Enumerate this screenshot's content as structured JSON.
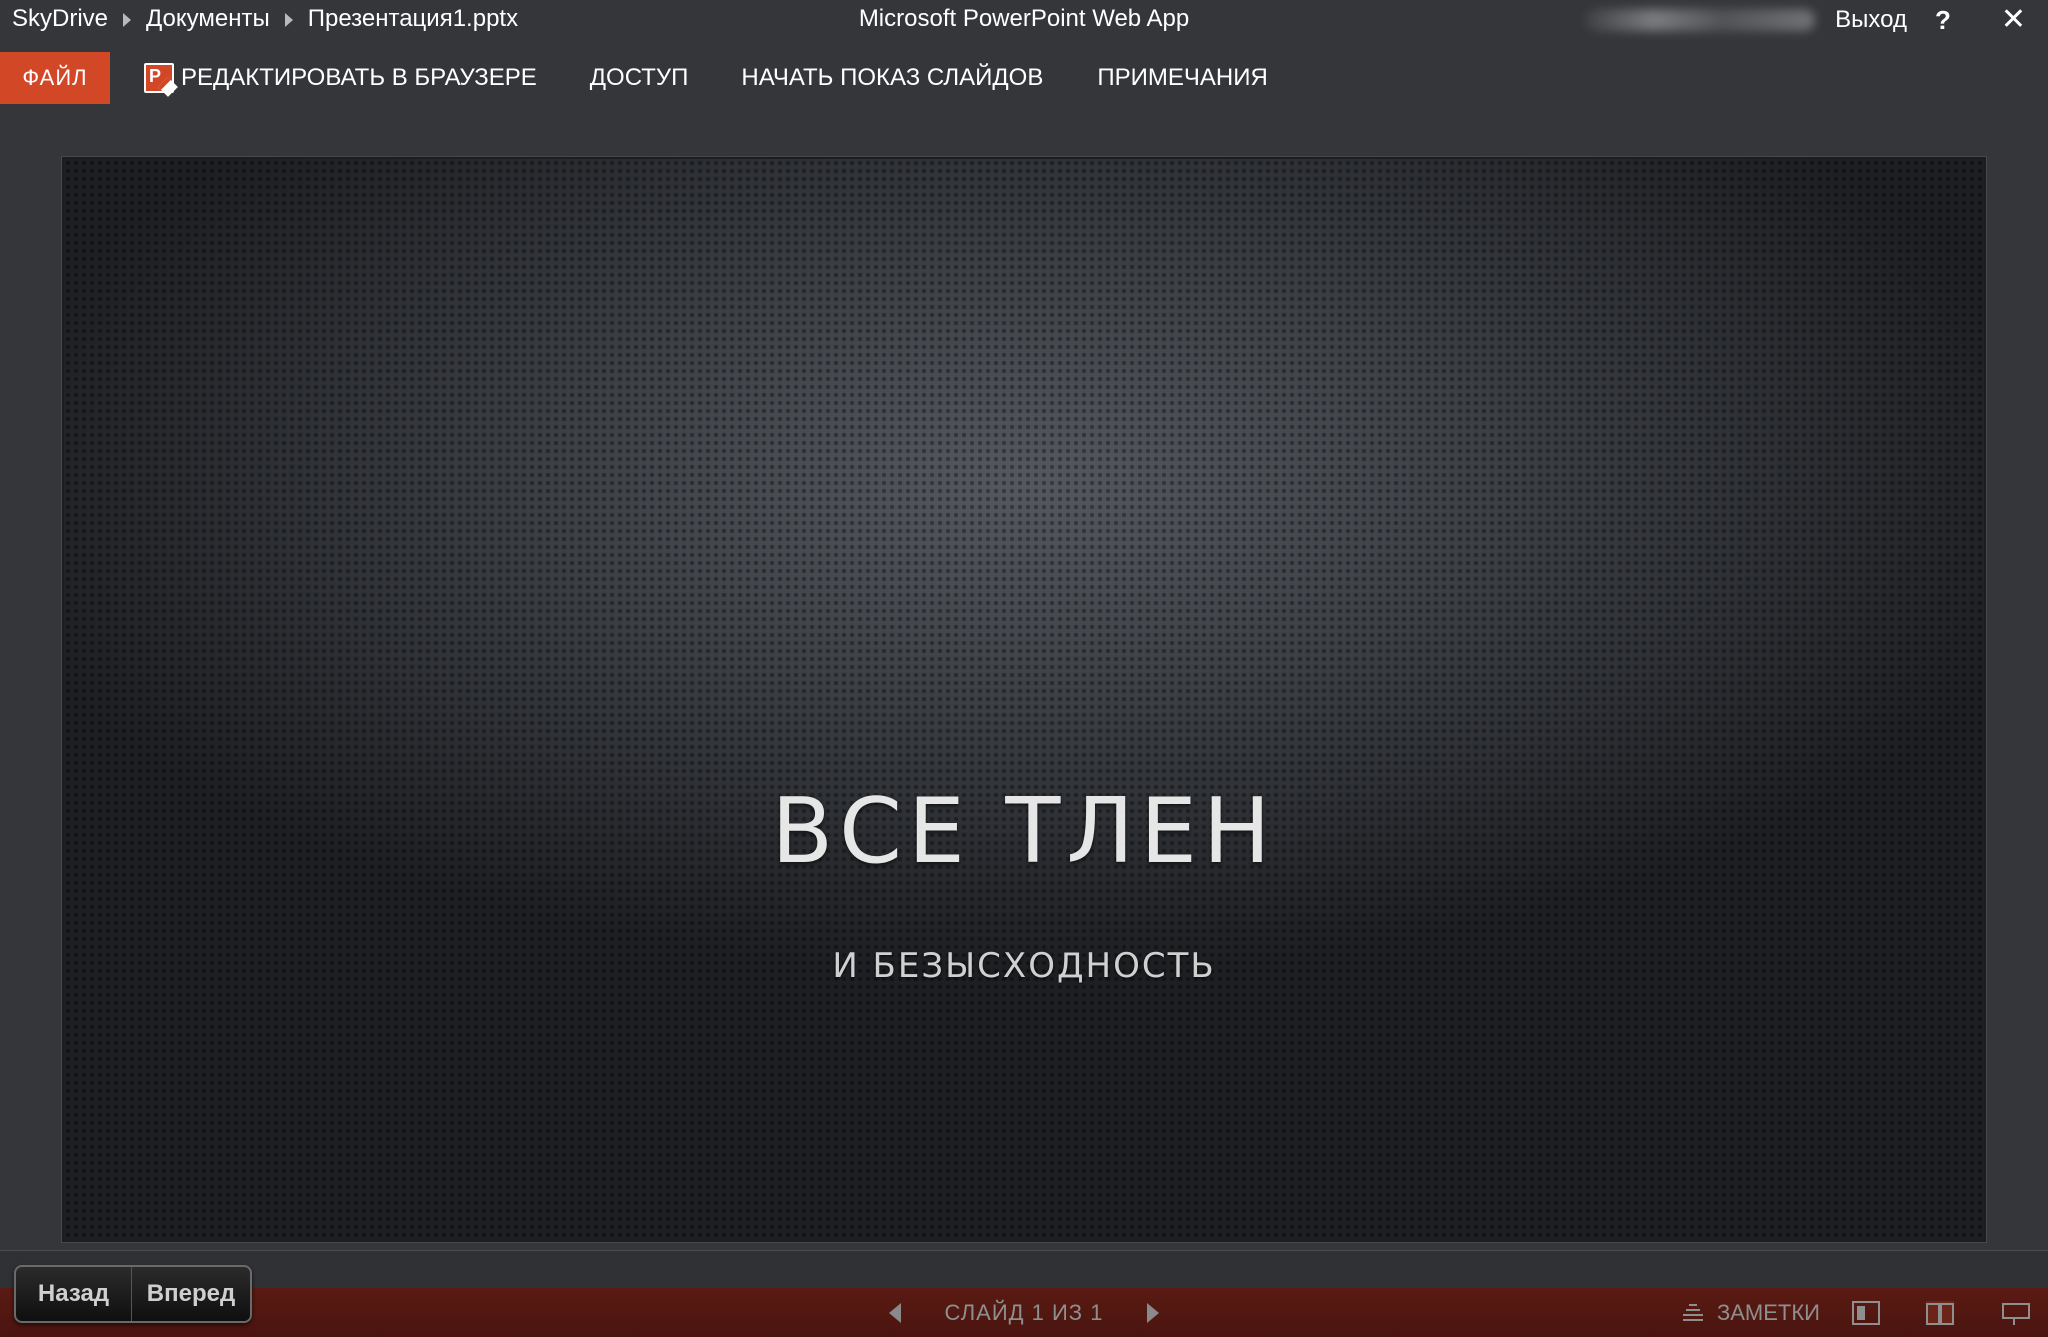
{
  "breadcrumb": [
    "SkyDrive",
    "Документы",
    "Презентация1.pptx"
  ],
  "app_title": "Microsoft PowerPoint Web App",
  "user": {
    "signout_label": "Выход",
    "help_glyph": "?",
    "close_glyph": "✕"
  },
  "ribbon": {
    "file_label": "ФАЙЛ",
    "edit_in_browser_label": "РЕДАКТИРОВАТЬ В БРАУЗЕРЕ",
    "share_label": "ДОСТУП",
    "start_slideshow_label": "НАЧАТЬ ПОКАЗ СЛАЙДОВ",
    "comments_label": "ПРИМЕЧАНИЯ"
  },
  "slide": {
    "title": "ВСЕ ТЛЕН",
    "subtitle": "И БЕЗЫСХОДНОСТЬ"
  },
  "navigation": {
    "back_label": "Назад",
    "forward_label": "Вперед"
  },
  "status": {
    "slide_counter": "СЛАЙД 1 ИЗ 1",
    "notes_label": "ЗАМЕТКИ",
    "active_view": "reading-view"
  },
  "colors": {
    "accent": "#d24726",
    "statusbar": "#4a1410",
    "background": "#34363a"
  },
  "icons": [
    "chevron-right-icon",
    "powerpoint-icon",
    "help-icon",
    "close-icon",
    "arrow-left-icon",
    "arrow-right-icon",
    "notes-icon",
    "normal-view-icon",
    "reading-view-icon",
    "slideshow-view-icon"
  ]
}
